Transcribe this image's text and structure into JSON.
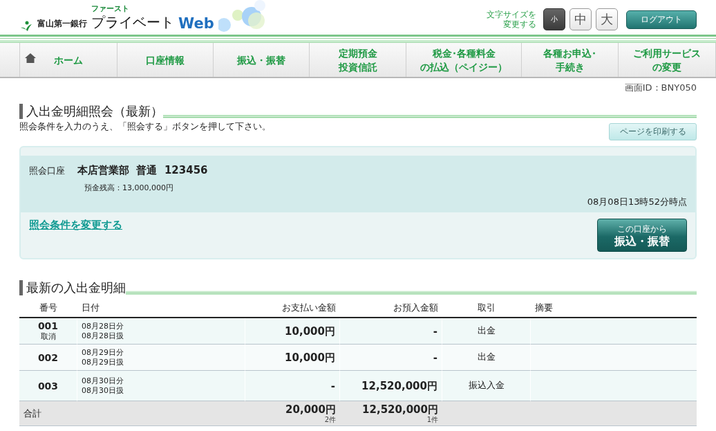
{
  "header": {
    "bank": "富山第一銀行",
    "ruby": "ファースト",
    "product": "プライベート",
    "web": "Web",
    "font_size": {
      "label_lines": [
        "文字サイズを",
        "変更する"
      ],
      "options": [
        {
          "label": "小",
          "selected": true
        },
        {
          "label": "中",
          "selected": false
        },
        {
          "label": "大",
          "selected": false
        }
      ]
    },
    "logout": "ログアウト"
  },
  "nav": [
    {
      "kind": "home",
      "lines": [
        "ホーム"
      ]
    },
    {
      "kind": "text",
      "lines": [
        "口座情報"
      ]
    },
    {
      "kind": "text",
      "lines": [
        "振込・振替"
      ]
    },
    {
      "kind": "text",
      "lines": [
        "定期預金",
        "投資信託"
      ]
    },
    {
      "kind": "text",
      "lines": [
        "税金･各種料金",
        "の払込（ペイジー）"
      ]
    },
    {
      "kind": "text",
      "lines": [
        "各種お申込･",
        "手続き"
      ]
    },
    {
      "kind": "text",
      "lines": [
        "ご利用サービス",
        "の変更"
      ]
    }
  ],
  "screen_id": "画面ID：BNY050",
  "page_title": "入出金明細照会（最新）",
  "instruction": "照会条件を入力のうえ、「照会する」ボタンを押して下さい。",
  "print_button": "ページを印刷する",
  "account": {
    "label": "照会口座",
    "name": "本店営業部  普通  123456",
    "balance": "預金残高：13,000,000円",
    "timestamp": "08月08日13時52分時点",
    "change_link": "照会条件を変更する",
    "transfer_button": [
      "この口座から",
      "振込・振替"
    ]
  },
  "section_title": "最新の入出金明細",
  "table": {
    "columns": [
      "番号",
      "日付",
      "お支払い金額",
      "お預入金額",
      "取引",
      "摘要"
    ],
    "rows": [
      {
        "number": "001",
        "note": "取消",
        "dates": [
          "08月28日分",
          "08月28日扱"
        ],
        "payment": "10,000円",
        "deposit": "-",
        "transaction": "出金"
      },
      {
        "number": "002",
        "dates": [
          "08月29日分",
          "08月29日扱"
        ],
        "payment": "10,000円",
        "deposit": "-",
        "transaction": "出金"
      },
      {
        "number": "003",
        "dates": [
          "08月30日分",
          "08月30日扱"
        ],
        "payment": "-",
        "deposit": "12,520,000円",
        "transaction": "振込入金"
      }
    ],
    "total": {
      "label": "合計",
      "payment": "20,000円",
      "payment_count": "2件",
      "deposit": "12,520,000円",
      "deposit_count": "1件"
    }
  }
}
